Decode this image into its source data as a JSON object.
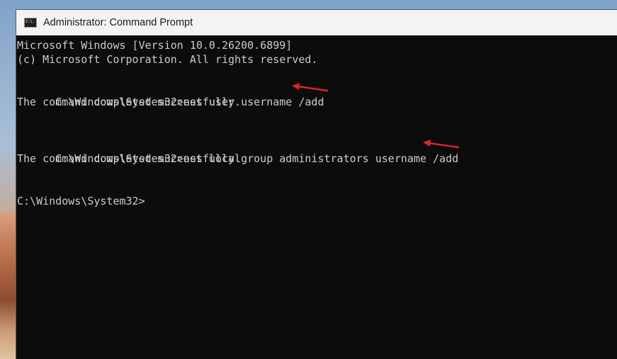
{
  "window": {
    "title": "Administrator: Command Prompt"
  },
  "console": {
    "lines": [
      "Microsoft Windows [Version 10.0.26200.6899]",
      "(c) Microsoft Corporation. All rights reserved.",
      "",
      "C:\\Windows\\System32>net user username /add",
      "The command completed successfully.",
      "",
      "",
      "C:\\Windows\\System32>net localgroup administrators username /add",
      "The command completed successfully.",
      "",
      "",
      "C:\\Windows\\System32>"
    ]
  },
  "annotations": {
    "arrow_color": "#e02424"
  },
  "icons": {
    "app_icon": "command-prompt-icon",
    "annotation_arrow": "red-arrow-icon"
  }
}
